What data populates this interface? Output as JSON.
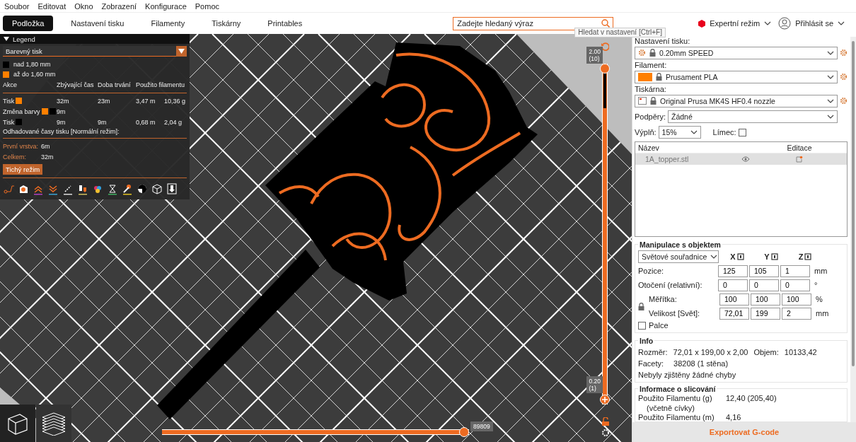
{
  "menu": [
    "Soubor",
    "Editovat",
    "Okno",
    "Zobrazení",
    "Konfigurace",
    "Pomoc"
  ],
  "tabs": [
    {
      "label": "Podložka",
      "selected": true
    },
    {
      "label": "Nastavení tisku",
      "selected": false
    },
    {
      "label": "Filamenty",
      "selected": false
    },
    {
      "label": "Tiskárny",
      "selected": false
    },
    {
      "label": "Printables",
      "selected": false
    }
  ],
  "search": {
    "placeholder": "Zadejte hledaný výraz",
    "tooltip": "Hledat v nastavení [Ctrl+F]"
  },
  "mode": {
    "label": "Expertní režim"
  },
  "account": {
    "label": "Přihlásit se"
  },
  "legend": {
    "title": "Legend",
    "expanded": true,
    "view_type": "Barevný tisk",
    "ranges": [
      {
        "label": "nad 1,80 mm",
        "color": "#000000"
      },
      {
        "label": "až do 1,60 mm",
        "color": "#ff8000"
      }
    ],
    "columns": [
      "Akce",
      "Zbývající čas",
      "Doba trvání",
      "Použito filamentu"
    ],
    "rows": [
      {
        "action": "Tisk",
        "swatches": [
          {
            "color": "#ff8000"
          }
        ],
        "remaining": "32m",
        "duration": "23m",
        "length": "3,47 m",
        "weight": "10,36 g"
      },
      {
        "action": "Změna barvy",
        "swatches": [
          {
            "color": "#ff8000"
          },
          {
            "color": "#000000"
          }
        ],
        "remaining": "9m"
      },
      {
        "action": "Tisk",
        "swatches": [
          {
            "color": "#000000"
          }
        ],
        "remaining": "9m",
        "duration": "9m",
        "length": "0,68 m",
        "weight": "2,04 g"
      }
    ],
    "estimate_title": "Odhadované časy tisku [Normální režim]:",
    "estimates": [
      {
        "label": "První vrstva:",
        "value": "6m"
      },
      {
        "label": "Celkem:",
        "value": "32m"
      }
    ],
    "mode_button": "Tichý režim"
  },
  "layer_slider": {
    "top": {
      "value": "2.00",
      "layer": "(10)",
      "level": 1
    },
    "bottom": {
      "value": "0.20",
      "layer": "(1)",
      "level": 0
    }
  },
  "move_slider": {
    "level": 1,
    "value": "89809"
  },
  "presets": [
    {
      "kind": "print",
      "label": "Nastavení tisku:",
      "value": "0.20mm SPEED"
    },
    {
      "kind": "filament",
      "label": "Filament:",
      "value": "Prusament PLA",
      "color": "#ff8000"
    },
    {
      "kind": "printer",
      "label": "Tiskárna:",
      "value": "Original Prusa MK4S HF0.4 nozzle"
    }
  ],
  "supports": {
    "label": "Podpěry:",
    "value": "Žádné"
  },
  "infill": {
    "label": "Výplň:",
    "value": "15%"
  },
  "brim": {
    "label": "Límec:",
    "checked": false
  },
  "objects": {
    "columns": [
      "Název",
      "Editace"
    ],
    "rows": [
      {
        "name": "1A_topper.stl",
        "selected": true
      }
    ]
  },
  "manipulation": {
    "title": "Manipulace s objektem",
    "coordinates": "Světové souřadnice",
    "axes": [
      "X",
      "Y",
      "Z"
    ],
    "rows": [
      {
        "label": "Pozice:",
        "values": [
          "125",
          "105",
          "1"
        ],
        "unit": "mm"
      },
      {
        "label": "Otočení (relativní):",
        "values": [
          "0",
          "0",
          "0"
        ],
        "unit": "°"
      },
      {
        "label": "Měřítka:",
        "values": [
          "100",
          "100",
          "100"
        ],
        "unit": "%"
      },
      {
        "label": "Velikost [Svět]:",
        "values": [
          "72,01",
          "199",
          "2"
        ],
        "unit": "mm"
      }
    ],
    "inches": {
      "label": "Palce",
      "checked": false
    }
  },
  "info": {
    "title": "Info",
    "size_label": "Rozměr:",
    "size": "72,01 x 199,00 x 2,00",
    "volume_label": "Objem:",
    "volume": "10133,42",
    "facets_label": "Facety:",
    "facets": "38208 (1 stěna)",
    "errors": "Nebyly zjištěny žádné chyby"
  },
  "slicing": {
    "title": "Informace o slicování",
    "rows": [
      {
        "label": "Použito Filamentu (g)",
        "sub": "(včetně cívky)",
        "value": "12,40 (205,40)"
      },
      {
        "label": "Použito Filamentu (m)",
        "value": "4,16"
      }
    ]
  },
  "export_button": "Exportovat G-code"
}
